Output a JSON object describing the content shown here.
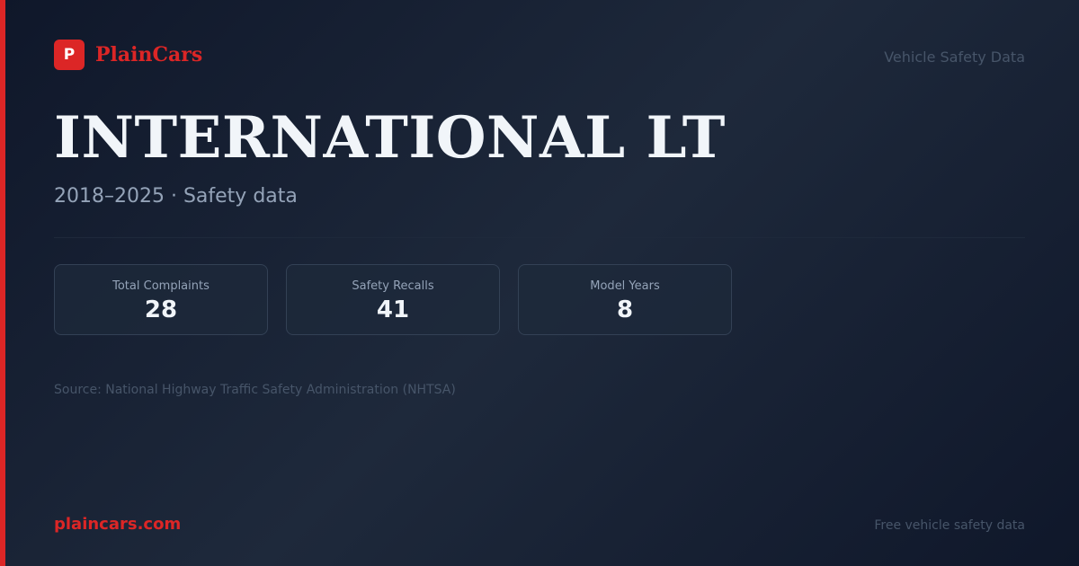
{
  "brand": {
    "logo_letter": "P",
    "name": "PlainCars"
  },
  "header": {
    "tagline": "Vehicle Safety Data"
  },
  "main": {
    "title": "INTERNATIONAL LT",
    "subtitle": "2018–2025 · Safety data"
  },
  "stats": [
    {
      "label": "Total Complaints",
      "value": "28"
    },
    {
      "label": "Safety Recalls",
      "value": "41"
    },
    {
      "label": "Model Years",
      "value": "8"
    }
  ],
  "source": "Source: National Highway Traffic Safety Administration (NHTSA)",
  "footer": {
    "domain": "plaincars.com",
    "tagline": "Free vehicle safety data"
  },
  "colors": {
    "accent": "#dc2626",
    "background": "#0f172a",
    "card_border": "#334155",
    "muted_text": "#94a3b8"
  }
}
